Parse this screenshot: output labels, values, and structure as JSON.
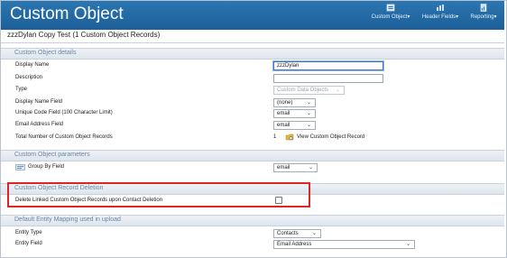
{
  "header": {
    "title": "Custom Object",
    "menus": [
      {
        "label": "Custom Object▾",
        "icon": "custom-object-icon"
      },
      {
        "label": "Header Fields▾",
        "icon": "header-fields-icon"
      },
      {
        "label": "Reporting▾",
        "icon": "reporting-icon"
      }
    ]
  },
  "subtitle": "zzzDylan Copy Test (1 Custom Object Records)",
  "details": {
    "section_title": "Custom Object details",
    "display_name": {
      "label": "Display Name",
      "value": "zzzDylan"
    },
    "description": {
      "label": "Description",
      "value": ""
    },
    "type": {
      "label": "Type",
      "value": "Custom Data Objects"
    },
    "display_name_field": {
      "label": "Display Name Field",
      "value": "(none)"
    },
    "unique_code_field": {
      "label": "Unique Code Field (100 Character Limit)",
      "value": "email"
    },
    "email_address_field": {
      "label": "Email Address Field",
      "value": "email"
    },
    "total_records": {
      "label": "Total Number of Custom Object Records",
      "value": "1",
      "link": "View Custom Object Record"
    }
  },
  "parameters": {
    "section_title": "Custom Object parameters",
    "group_by": {
      "label": "Group By Field",
      "value": "email"
    }
  },
  "deletion": {
    "section_title": "Custom Object Record Deletion",
    "delete_linked": {
      "label": "Delete Linked Custom Object Records upon Contact Deletion",
      "checked": false
    }
  },
  "mapping": {
    "section_title": "Default Entity Mapping used in upload",
    "entity_type": {
      "label": "Entity Type",
      "value": "Contacts"
    },
    "entity_field": {
      "label": "Entity Field",
      "value": "Email Address"
    }
  },
  "colors": {
    "header": "#1d5f98",
    "highlight": "#e02424",
    "section_text": "#6b86a3"
  }
}
